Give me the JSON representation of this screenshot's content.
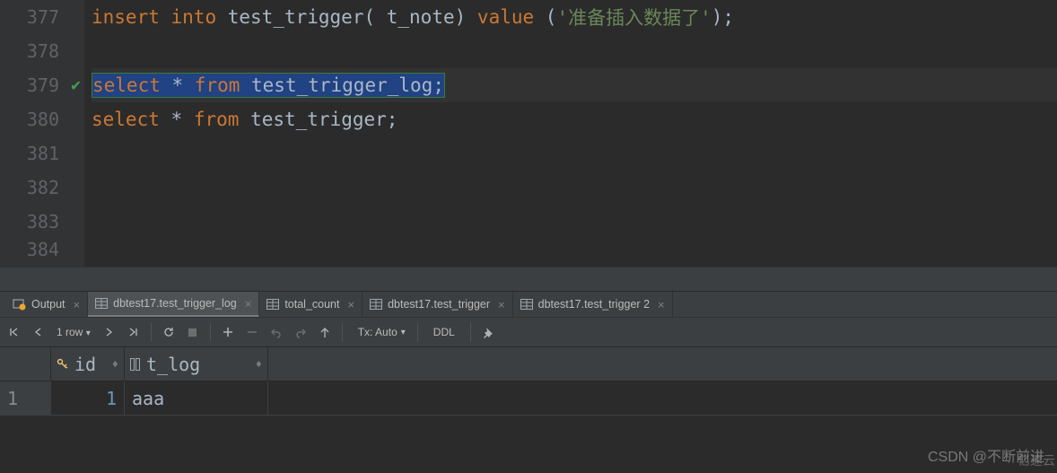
{
  "editor": {
    "lines": [
      {
        "num": "377"
      },
      {
        "num": "378"
      },
      {
        "num": "379",
        "checked": true
      },
      {
        "num": "380"
      },
      {
        "num": "381"
      },
      {
        "num": "382"
      },
      {
        "num": "383"
      },
      {
        "num": "384"
      }
    ],
    "code": {
      "l1_insert": "insert",
      "l1_into": "into",
      "l1_tbl": "test_trigger( t_note)",
      "l1_value": "value",
      "l1_paren1": "(",
      "l1_str": "'准备插入数据了'",
      "l1_paren2": ");",
      "l3_full": "select * from test_trigger_log;",
      "l4_select": "select",
      "l4_star": "*",
      "l4_from": "from",
      "l4_tbl": "test_trigger;"
    }
  },
  "tabs": {
    "output": "Output",
    "t1": "dbtest17.test_trigger_log",
    "t2": "total_count",
    "t3": "dbtest17.test_trigger",
    "t4": "dbtest17.test_trigger 2"
  },
  "toolbar": {
    "rows_label": "1 row",
    "tx_label": "Tx: Auto",
    "ddl_label": "DDL"
  },
  "results": {
    "columns": {
      "id": "id",
      "tlog": "t_log"
    },
    "rows": [
      {
        "num": "1",
        "id": "1",
        "tlog": "aaa"
      }
    ]
  },
  "watermark": "CSDN @不断前进",
  "watermark2": "亿速云"
}
